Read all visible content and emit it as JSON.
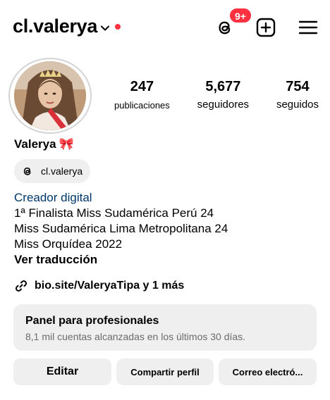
{
  "header": {
    "username": "cl.valerya",
    "threads_badge": "9+",
    "icons": [
      "chevron-down-icon",
      "threads-icon",
      "add-post-icon",
      "menu-icon"
    ]
  },
  "stats": [
    {
      "value": "247",
      "label": "publicaciones"
    },
    {
      "value": "5,677",
      "label": "seguidores"
    },
    {
      "value": "754",
      "label": "seguidos"
    }
  ],
  "profile": {
    "display_name": "Valerya",
    "emoji": "🎀",
    "threads_handle": "cl.valerya",
    "category": "Creador digital",
    "bio_lines": [
      "1ª Finalista Miss Sudamérica Perú 24",
      "Miss Sudamérica Lima Metropolitana 24",
      "Miss Orquídea 2022"
    ],
    "translate_label": "Ver traducción",
    "link_text": "bio.site/ValeryaTipa y 1 más"
  },
  "panel": {
    "title": "Panel para profesionales",
    "subtitle": "8,1 mil cuentas alcanzadas en los últimos 30 días."
  },
  "buttons": {
    "edit": "Editar",
    "share": "Compartir perfil",
    "email": "Correo electró..."
  },
  "colors": {
    "notification_red": "#ff3040",
    "category_blue": "#00376b",
    "button_gray": "#efefef",
    "muted_text": "#6b6b6b"
  }
}
